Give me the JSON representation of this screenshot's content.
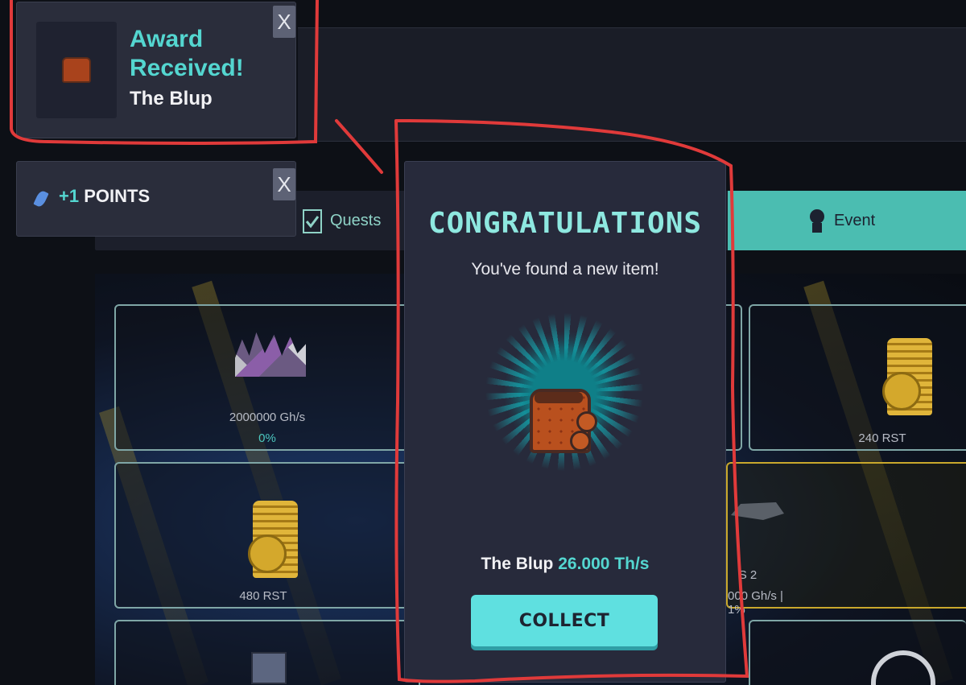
{
  "tabs": {
    "quests_label": "Quests",
    "event_label": "Event"
  },
  "cards": {
    "crystal_hashrate": "2000000 Gh/s",
    "crystal_progress": "0%",
    "coins_top_right": "240 RST",
    "coins_left": "480 RST",
    "rig_name": "S 2",
    "rig_info": "000 Gh/s | 1%"
  },
  "notifications": {
    "award_title": "Award Received!",
    "award_item": "The Blup",
    "points_plus": "+1",
    "points_label": "POINTS",
    "close_label": "X"
  },
  "modal": {
    "title": "CONGRATULATIONS",
    "subtitle": "You've found a new item!",
    "item_name": "The Blup",
    "item_rate": "26.000 Th/s",
    "collect_label": "COLLECT"
  },
  "colors": {
    "accent": "#54d6d0",
    "panel": "#272a3b",
    "annotation": "#e03a3a"
  }
}
